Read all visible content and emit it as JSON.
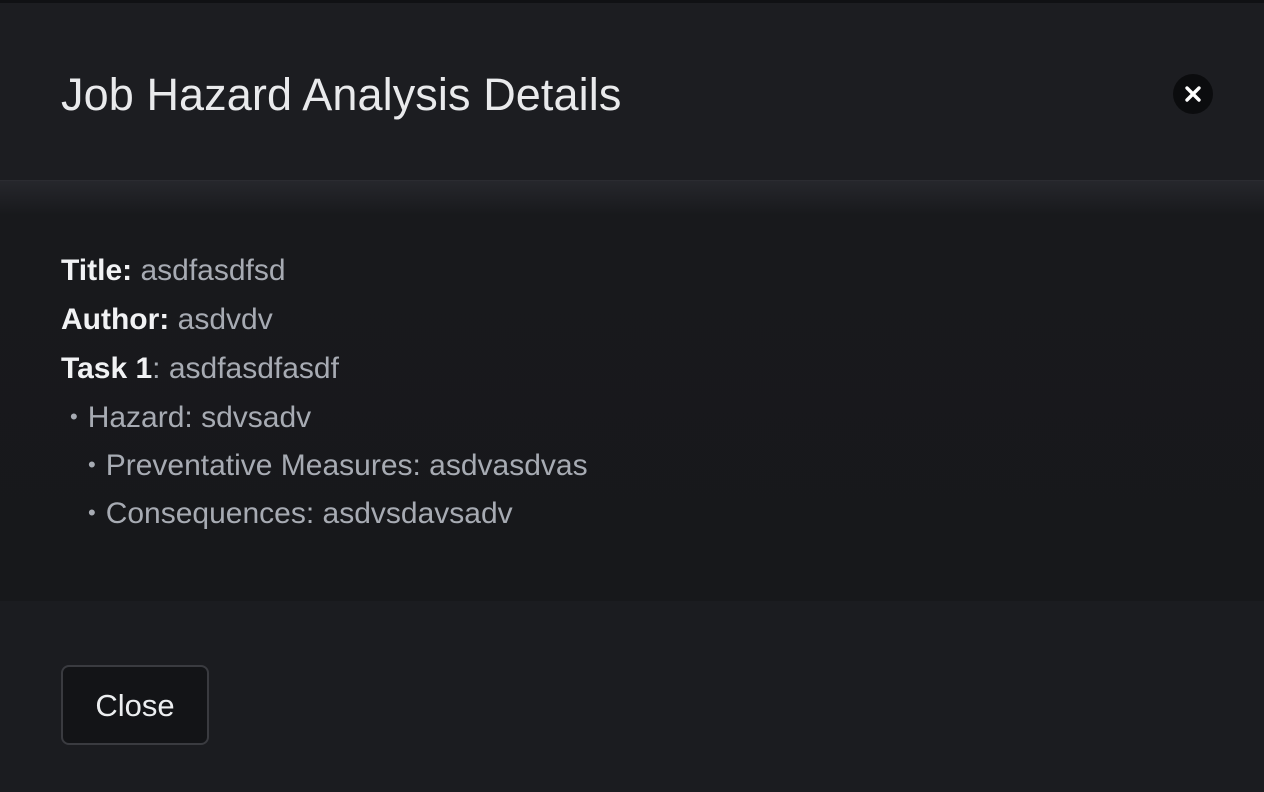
{
  "modal": {
    "title": "Job Hazard Analysis Details"
  },
  "details": {
    "title_label": "Title:",
    "title_value": "asdfasdfsd",
    "author_label": "Author:",
    "author_value": "asdvdv",
    "task_label": "Task 1",
    "task_value": ": asdfasdfasdf",
    "hazard_text": "Hazard: sdvsadv",
    "preventative_text": "Preventative Measures: asdvasdvas",
    "consequences_text": "Consequences: asdvsdavsadv",
    "bullet": "•"
  },
  "footer": {
    "close_label": "Close"
  },
  "icons": {
    "header_close": "close-icon"
  },
  "colors": {
    "background": "#1b1c20",
    "title_text": "#e9eaec",
    "value_text": "#a7abb3",
    "label_text": "#f1f2f4"
  }
}
